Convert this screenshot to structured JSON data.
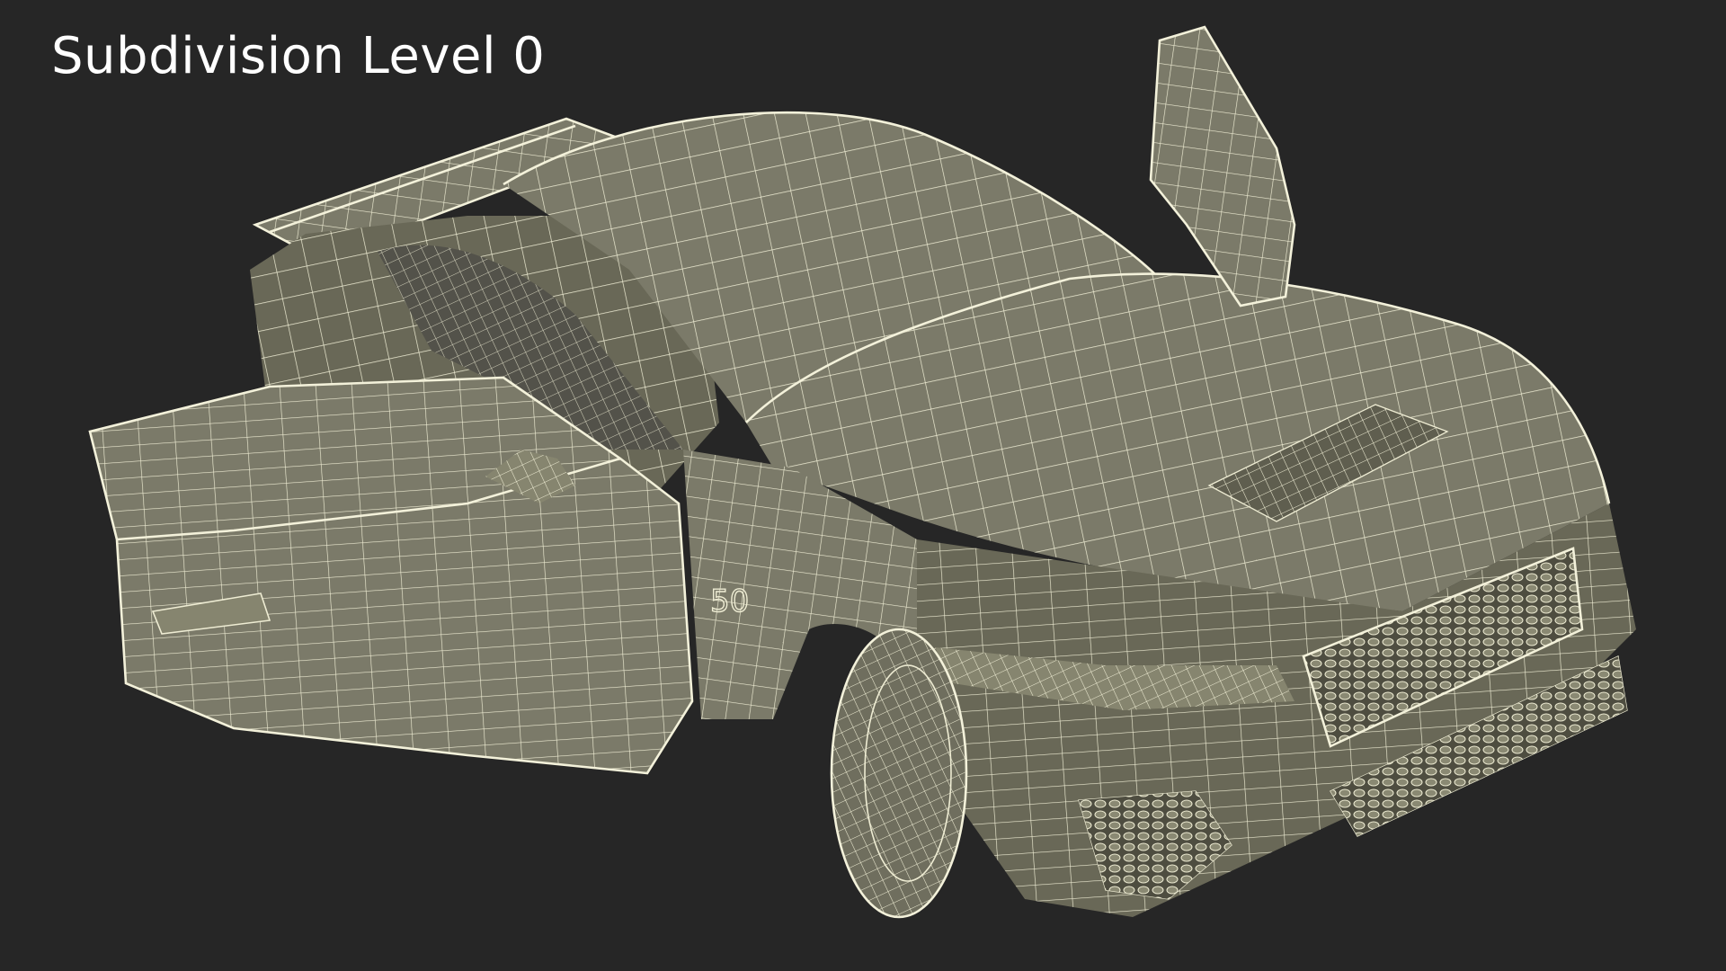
{
  "caption": "Subdivision Level 0",
  "model": {
    "fender_badge": "50"
  },
  "colors": {
    "background": "#262626",
    "surface": "#7b7a69",
    "wireframe": "#eeecd3",
    "caption_text": "#ffffff"
  }
}
